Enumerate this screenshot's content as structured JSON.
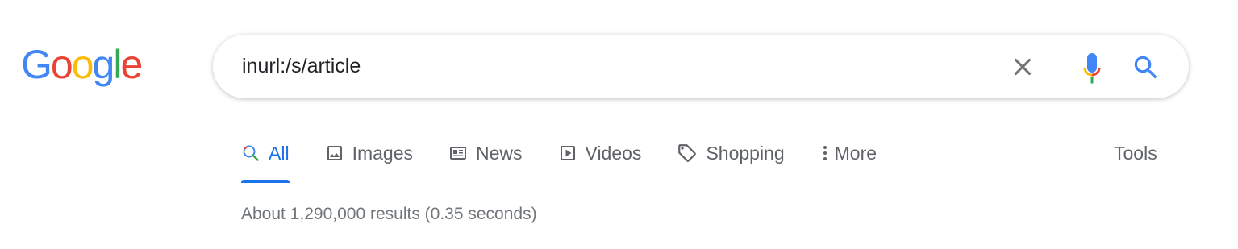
{
  "logo": {
    "letters": [
      "G",
      "o",
      "o",
      "g",
      "l",
      "e"
    ],
    "colors": [
      "#4285f4",
      "#ea4335",
      "#fbbc05",
      "#4285f4",
      "#34a853",
      "#ea4335"
    ]
  },
  "search": {
    "value": "inurl:/s/article"
  },
  "tabs": [
    {
      "label": "All",
      "icon": "search-icon",
      "active": true
    },
    {
      "label": "Images",
      "icon": "image-icon",
      "active": false
    },
    {
      "label": "News",
      "icon": "news-icon",
      "active": false
    },
    {
      "label": "Videos",
      "icon": "play-icon",
      "active": false
    },
    {
      "label": "Shopping",
      "icon": "tag-icon",
      "active": false
    },
    {
      "label": "More",
      "icon": "more-vert-icon",
      "active": false
    }
  ],
  "tools_label": "Tools",
  "results_stats": "About 1,290,000 results (0.35 seconds)",
  "colors": {
    "accent": "#1a73e8",
    "tab_text": "#5f6368",
    "stats_text": "#70757a"
  }
}
